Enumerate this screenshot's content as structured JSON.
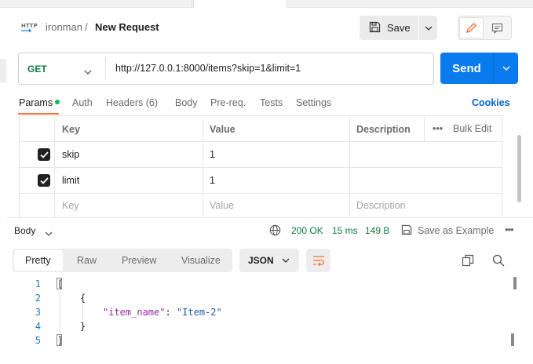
{
  "header": {
    "icon": "http-file-icon",
    "icon_text": "HTTP",
    "breadcrumb_parent": "ironman",
    "breadcrumb_sep": "/",
    "title": "New Request",
    "save_label": "Save"
  },
  "request": {
    "method": "GET",
    "url": "http://127.0.0.1:8000/items?skip=1&limit=1",
    "send_label": "Send"
  },
  "tabs": [
    {
      "label": "Params",
      "active": true,
      "dot": true
    },
    {
      "label": "Auth"
    },
    {
      "label": "Headers (6)"
    },
    {
      "label": "Body"
    },
    {
      "label": "Pre-req."
    },
    {
      "label": "Tests"
    },
    {
      "label": "Settings"
    }
  ],
  "cookies_label": "Cookies",
  "params_table": {
    "headers": {
      "key": "Key",
      "value": "Value",
      "description": "Description",
      "bulk_edit": "Bulk Edit"
    },
    "rows": [
      {
        "checked": true,
        "key": "skip",
        "value": "1",
        "description": ""
      },
      {
        "checked": true,
        "key": "limit",
        "value": "1",
        "description": ""
      }
    ],
    "placeholder": {
      "key": "Key",
      "value": "Value",
      "description": "Description"
    }
  },
  "response": {
    "body_label": "Body",
    "status": "200 OK",
    "time": "15 ms",
    "size": "149 B",
    "save_example": "Save as Example",
    "view_tabs": [
      "Pretty",
      "Raw",
      "Preview",
      "Visualize"
    ],
    "active_view": "Pretty",
    "format": "JSON",
    "line_numbers": [
      "1",
      "2",
      "3",
      "4",
      "5"
    ],
    "code": {
      "line1": "[",
      "line2": "{",
      "key": "\"item_name\"",
      "colon": ": ",
      "value": "\"Item-2\"",
      "line4": "}",
      "line5": "]"
    }
  },
  "colors": {
    "accent_orange": "#ff6c37",
    "send_blue": "#097bed",
    "success_green": "#0b7b3e",
    "link_blue": "#0265d2"
  }
}
